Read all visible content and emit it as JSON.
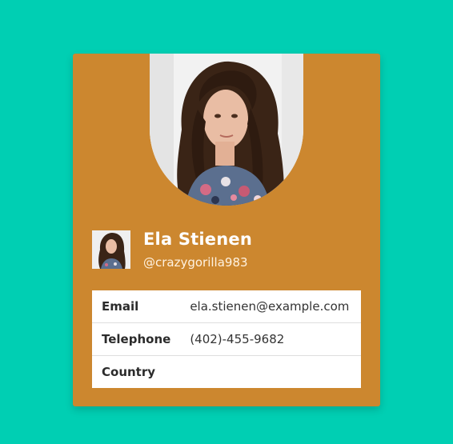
{
  "profile": {
    "name": "Ela Stienen",
    "username": "@crazygorilla983"
  },
  "details": [
    {
      "label": "Email",
      "value": "ela.stienen@example.com"
    },
    {
      "label": "Telephone",
      "value": "(402)-455-9682"
    },
    {
      "label": "Country",
      "value": ""
    }
  ],
  "colors": {
    "background": "#00cfb3",
    "card": "#cc872f",
    "table": "#ffffff"
  },
  "icons": {
    "hero_photo": "profile-photo",
    "thumbnail": "avatar"
  }
}
